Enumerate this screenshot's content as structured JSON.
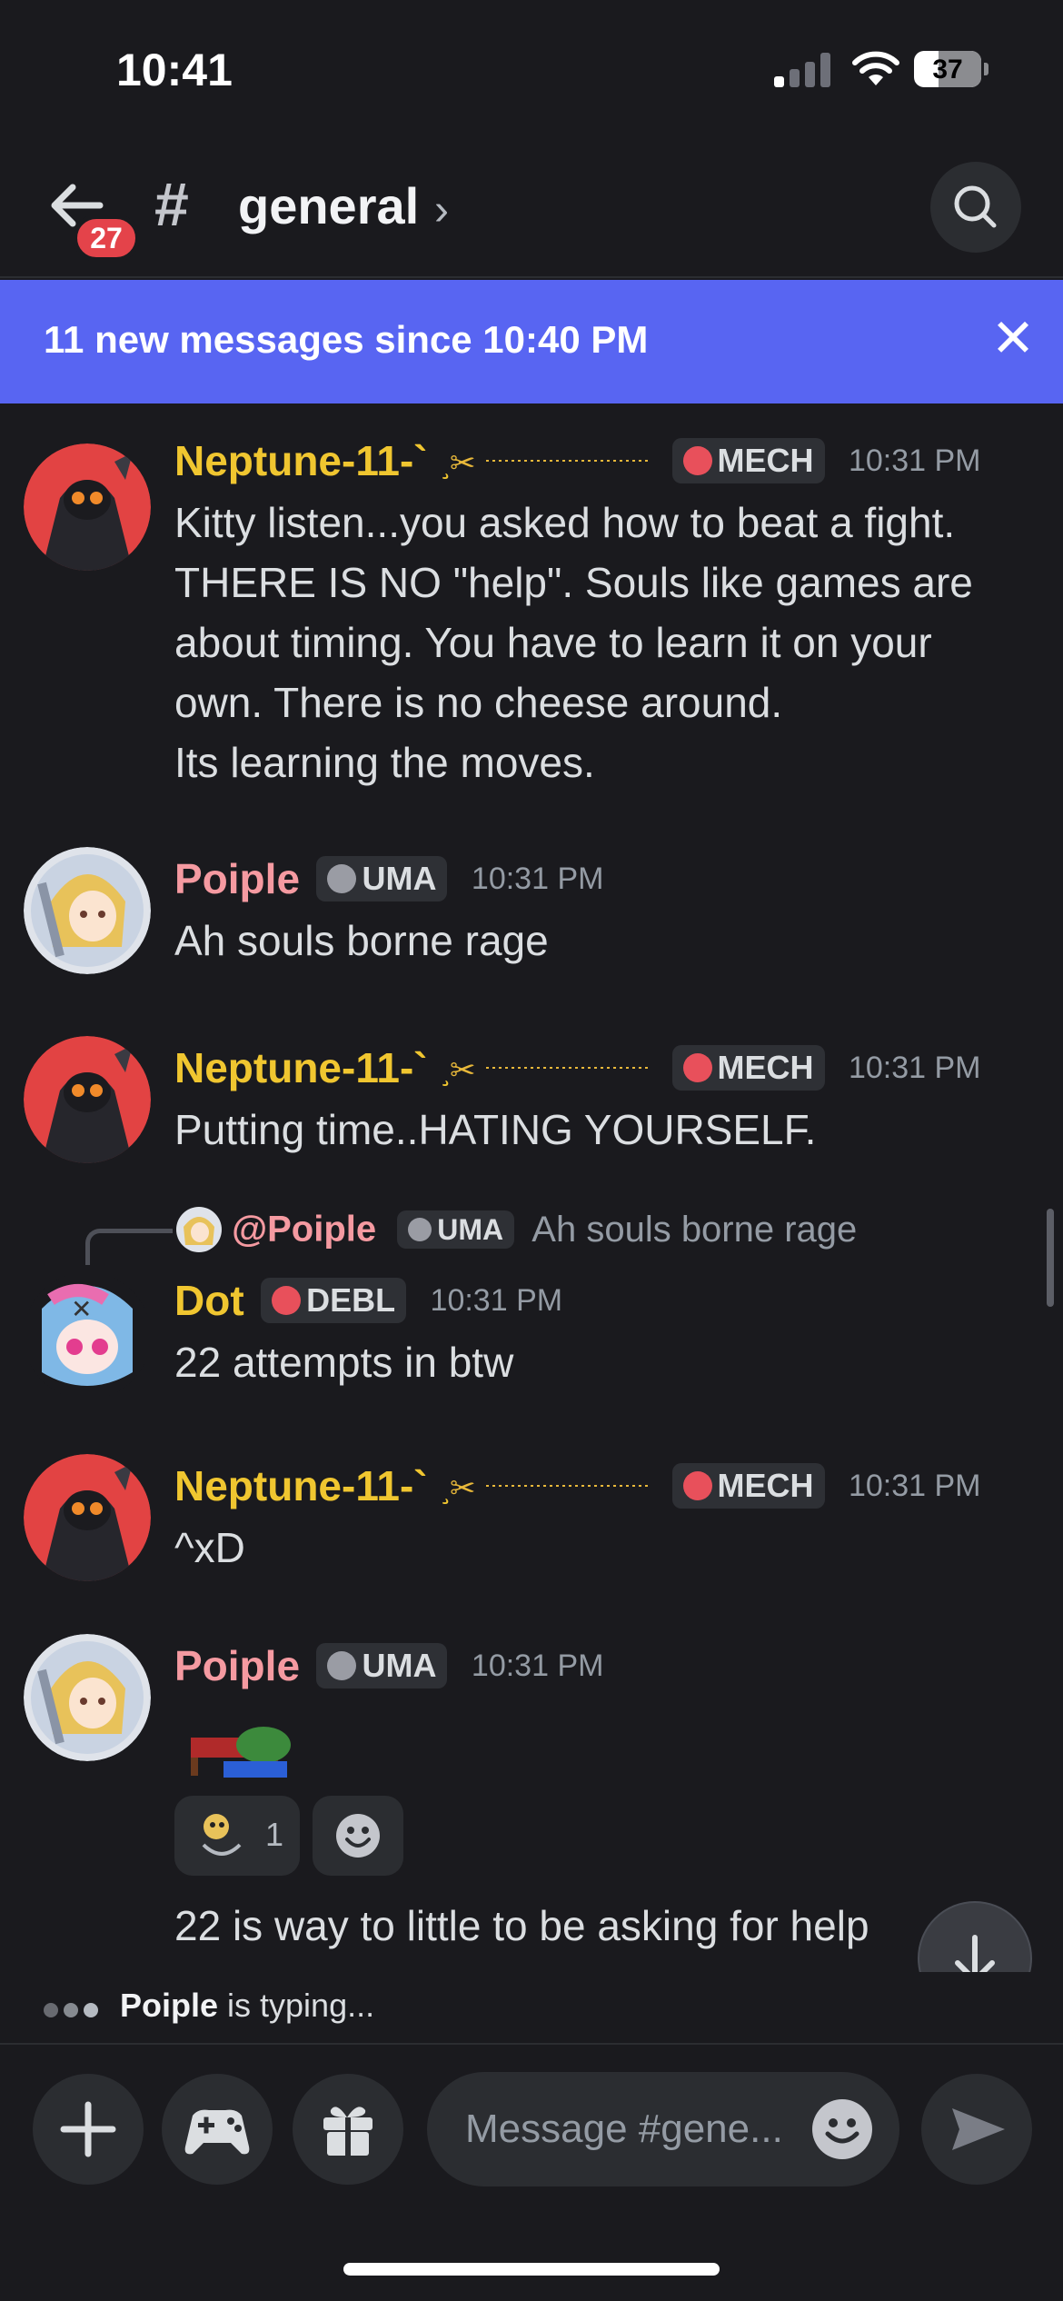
{
  "status_bar": {
    "time": "10:41",
    "battery": "37",
    "battery_level": 0.37
  },
  "header": {
    "unread_badge": "27",
    "channel_prefix": "#",
    "channel_name": "general",
    "chevron": "›"
  },
  "new_messages_bar": {
    "text": "11 new messages since 10:40 PM"
  },
  "messages": [
    {
      "username": "Neptune-11-`",
      "role": "MECH",
      "time": "10:31 PM",
      "lines": [
        "Kitty listen...you asked how to beat a fight. THERE IS NO \"help\". Souls like games are about timing. You have to learn it on your own. There is no cheese around.",
        "Its learning the moves."
      ]
    },
    {
      "username": "Poiple",
      "role": "UMA",
      "time": "10:31 PM",
      "text": "Ah souls borne rage"
    },
    {
      "username": "Neptune-11-`",
      "role": "MECH",
      "time": "10:31 PM",
      "text": "Putting time..HATING YOURSELF."
    },
    {
      "reply": {
        "mention": "@Poiple",
        "role": "UMA",
        "text": "Ah souls borne rage"
      },
      "username": "Dot",
      "role": "DEBL",
      "time": "10:31 PM",
      "text": "22 attempts in btw"
    },
    {
      "username": "Neptune-11-`",
      "role": "MECH",
      "time": "10:31 PM",
      "text": "^xD"
    },
    {
      "username": "Poiple",
      "role": "UMA",
      "time": "10:31 PM",
      "reaction_count": "1",
      "partial_text": "22 is way to little to be asking for help"
    }
  ],
  "typing": {
    "user": "Poiple",
    "suffix": " is typing..."
  },
  "composer": {
    "placeholder": "Message #gene..."
  },
  "colors": {
    "accent": "#5865f2",
    "username_gold": "#f0c630",
    "username_pink": "#f59aa1",
    "badge_red": "#e4434a"
  },
  "icons": {
    "back": "arrow-left-icon",
    "search": "search-icon",
    "close": "close-icon",
    "add": "plus-icon",
    "games": "gamepad-icon",
    "gift": "gift-icon",
    "emoji": "smiley-icon",
    "send": "send-icon",
    "scroll": "arrow-down-icon"
  }
}
